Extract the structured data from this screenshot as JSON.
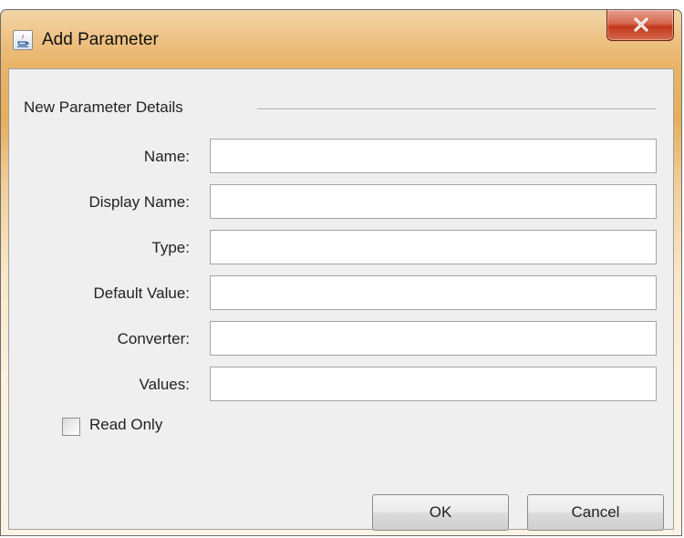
{
  "window": {
    "title": "Add Parameter",
    "icon": "java-app-icon",
    "close_icon": "close-icon"
  },
  "group": {
    "title": "New Parameter Details"
  },
  "fields": [
    {
      "label": "Name:",
      "value": ""
    },
    {
      "label": "Display Name:",
      "value": ""
    },
    {
      "label": "Type:",
      "value": ""
    },
    {
      "label": "Default Value:",
      "value": ""
    },
    {
      "label": "Converter:",
      "value": ""
    },
    {
      "label": "Values:",
      "value": ""
    }
  ],
  "read_only": {
    "label": "Read Only",
    "checked": false
  },
  "buttons": {
    "ok": "OK",
    "cancel": "Cancel"
  },
  "colors": {
    "title_bar": "#e8b468",
    "close_button": "#c1391c",
    "client_background": "#efefef"
  }
}
